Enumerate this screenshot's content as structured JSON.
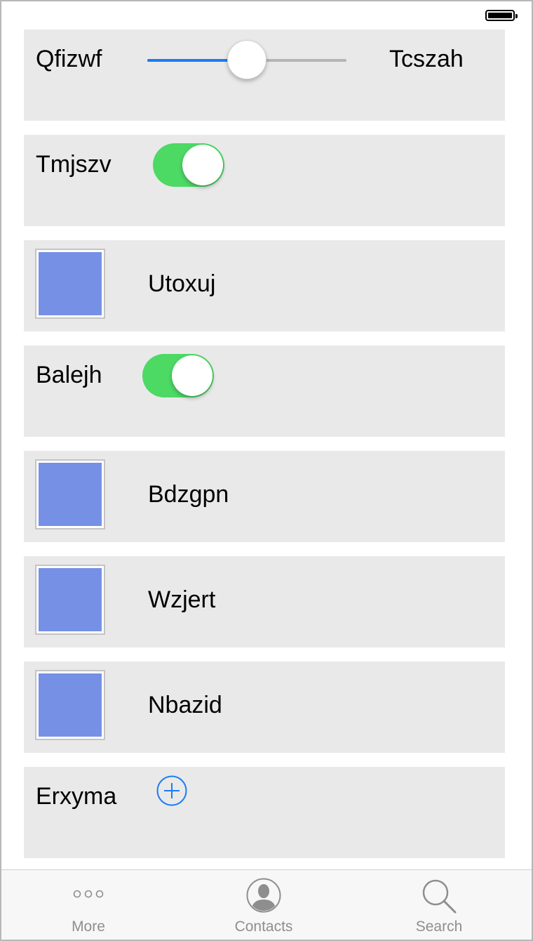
{
  "colors": {
    "row_bg": "#e9e9e9",
    "accent_blue": "#1a7cf5",
    "toggle_on": "#4cd964",
    "swatch_fill": "#7690e6",
    "tab_inactive": "#8e8e8e"
  },
  "status_bar": {
    "battery_icon": "battery-full-icon"
  },
  "slider_row": {
    "left_label": "Qfizwf",
    "right_label": "Tcszah",
    "value": 0.5
  },
  "toggle_rows": [
    {
      "label": "Tmjszv",
      "on": true
    },
    {
      "label": "Balejh",
      "on": true
    }
  ],
  "image_rows": [
    {
      "label": "Utoxuj"
    },
    {
      "label": "Bdzgpn"
    },
    {
      "label": "Wzjert"
    },
    {
      "label": "Nbazid"
    }
  ],
  "add_row": {
    "label": "Erxyma",
    "icon": "add-circle-icon"
  },
  "tab_bar": {
    "tabs": [
      {
        "label": "More",
        "icon": "more-icon"
      },
      {
        "label": "Contacts",
        "icon": "contacts-icon"
      },
      {
        "label": "Search",
        "icon": "search-icon"
      }
    ]
  }
}
